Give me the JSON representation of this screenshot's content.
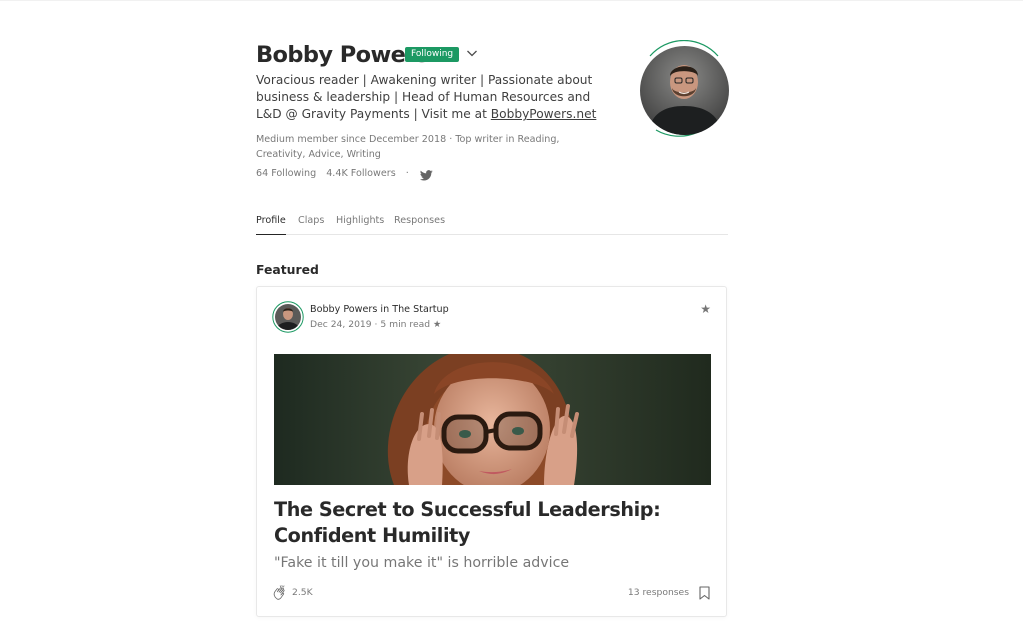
{
  "profile": {
    "name": "Bobby Powers",
    "following_label": "Following",
    "bio_text": "Voracious reader | Awakening writer | Passionate about business & leadership | Head of Human Resources and L&D @ Gravity Payments | Visit me at ",
    "bio_link": "BobbyPowers.net",
    "meta": "Medium member since December 2018 · Top writer in Reading, Creativity, Advice, Writing",
    "following_count": "64 Following",
    "followers_count": "4.4K Followers",
    "stats_separator": "·"
  },
  "tabs": [
    {
      "label": "Profile",
      "active": true
    },
    {
      "label": "Claps",
      "active": false
    },
    {
      "label": "Highlights",
      "active": false
    },
    {
      "label": "Responses",
      "active": false
    }
  ],
  "featured": {
    "section_title": "Featured",
    "author_line": "Bobby Powers in The Startup",
    "date_line": "Dec 24, 2019 · 5 min read ★",
    "star_glyph": "★",
    "title": "The Secret to Successful Leadership: Confident Humility",
    "subtitle": "\"Fake it till you make it\" is horrible advice",
    "claps": "2.5K",
    "responses": "13 responses"
  },
  "colors": {
    "accent_green": "#1c9963",
    "text_primary": "rgba(0,0,0,0.84)",
    "text_secondary": "rgba(0,0,0,0.54)"
  },
  "icons": {
    "chevron": "chevron-down-icon",
    "twitter": "twitter-icon",
    "clap": "clap-icon",
    "bookmark": "bookmark-icon",
    "star": "star-icon"
  }
}
